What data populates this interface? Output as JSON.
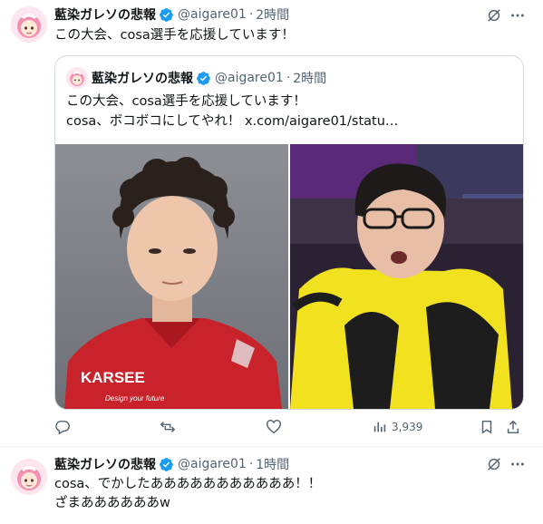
{
  "tweet1": {
    "display_name": "藍染ガレソの悲報",
    "handle": "@aigare01",
    "separator": "·",
    "time": "2時間",
    "text": "この大会、cosa選手を応援しています！"
  },
  "quote": {
    "display_name": "藍染ガレソの悲報",
    "handle": "@aigare01",
    "separator": "·",
    "time": "2時間",
    "line1": "この大会、cosa選手を応援しています！",
    "line2_text": "cosa、ボコボコにしてやれ！ ",
    "line2_link": "x.com/aigare01/statu…",
    "jersey_text": "KARSEE",
    "jersey_tagline": "Design your future"
  },
  "actions": {
    "views": "3,939"
  },
  "tweet2": {
    "display_name": "藍染ガレソの悲報",
    "handle": "@aigare01",
    "separator": "·",
    "time": "1時間",
    "line1": "cosa、でかしたあああああああああああ！！",
    "line2": "ざまああああああw"
  },
  "colors": {
    "verified": "#1d9bf0",
    "muted": "#536471",
    "border": "#cfd9de",
    "jersey_red": "#c8222b",
    "jersey_yellow": "#f2e11f"
  }
}
